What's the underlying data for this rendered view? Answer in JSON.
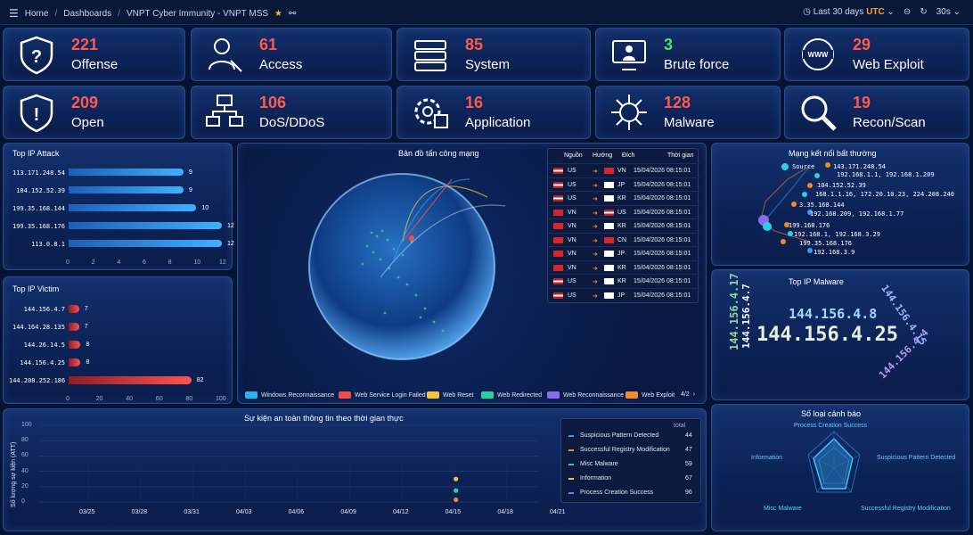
{
  "topbar": {
    "home": "Home",
    "dashboards": "Dashboards",
    "title": "VNPT Cyber Immunity - VNPT MSS",
    "time_range": "Last 30 days",
    "timezone": "UTC",
    "refresh": "30s"
  },
  "stats": [
    {
      "value": "221",
      "label": "Offense",
      "icon": "shield-question-icon"
    },
    {
      "value": "61",
      "label": "Access",
      "icon": "user-key-icon"
    },
    {
      "value": "85",
      "label": "System",
      "icon": "server-icon"
    },
    {
      "value": "3",
      "label": "Brute force",
      "icon": "monitor-user-icon"
    },
    {
      "value": "29",
      "label": "Web Exploit",
      "icon": "www-globe-icon"
    },
    {
      "value": "209",
      "label": "Open",
      "icon": "shield-alert-icon"
    },
    {
      "value": "106",
      "label": "DoS/DDoS",
      "icon": "network-computers-icon"
    },
    {
      "value": "16",
      "label": "Application",
      "icon": "gear-app-icon"
    },
    {
      "value": "128",
      "label": "Malware",
      "icon": "virus-icon"
    },
    {
      "value": "19",
      "label": "Recon/Scan",
      "icon": "magnifier-icon"
    }
  ],
  "top_ip_attack": {
    "title": "Top IP Attack",
    "items": [
      {
        "ip": "113.171.248.54",
        "value": 9
      },
      {
        "ip": "104.152.52.39",
        "value": 9
      },
      {
        "ip": "199.35.168.144",
        "value": 10
      },
      {
        "ip": "199.35.168.176",
        "value": 12
      },
      {
        "ip": "113.0.8.1",
        "value": 12
      }
    ],
    "ticks": [
      "0",
      "2",
      "4",
      "6",
      "8",
      "10",
      "12"
    ],
    "max": 12,
    "color": "#2f9bf2"
  },
  "top_ip_victim": {
    "title": "Top IP Victim",
    "items": [
      {
        "ip": "144.156.4.7",
        "value": 7
      },
      {
        "ip": "144.164.28.135",
        "value": 7
      },
      {
        "ip": "144.26.14.5",
        "value": 8
      },
      {
        "ip": "144.156.4.25",
        "value": 8
      },
      {
        "ip": "144.208.252.186",
        "value": 82
      }
    ],
    "ticks": [
      "0",
      "20",
      "40",
      "60",
      "80",
      "100"
    ],
    "max": 100,
    "color": "#ff4b4b"
  },
  "attack_map": {
    "title": "Bản đồ tấn công mạng",
    "headers": {
      "source": "Nguồn",
      "direction": "Hướng",
      "dest": "Đích",
      "time": "Thời gian"
    },
    "rows": [
      {
        "src": "US",
        "dst": "VN",
        "time": "15/04/2026 08:15:01"
      },
      {
        "src": "US",
        "dst": "JP",
        "time": "15/04/2026 08:15:01"
      },
      {
        "src": "US",
        "dst": "KR",
        "time": "15/04/2026 08:15:01"
      },
      {
        "src": "VN",
        "dst": "US",
        "time": "15/04/2026 08:15:01"
      },
      {
        "src": "VN",
        "dst": "KR",
        "time": "15/04/2026 08:15:01"
      },
      {
        "src": "VN",
        "dst": "CN",
        "time": "15/04/2026 08:15:01"
      },
      {
        "src": "VN",
        "dst": "JP",
        "time": "15/04/2026 08:15:01"
      },
      {
        "src": "VN",
        "dst": "KR",
        "time": "15/04/2026 08:15:01"
      },
      {
        "src": "US",
        "dst": "KR",
        "time": "15/04/2026 08:15:01"
      },
      {
        "src": "US",
        "dst": "JP",
        "time": "15/04/2026 08:15:01"
      }
    ],
    "legend": [
      {
        "label": "Windows Reconnaissance",
        "color": "#2bb3ef"
      },
      {
        "label": "Web Service Login Failed",
        "color": "#ef4b4b"
      },
      {
        "label": "Web Reset",
        "color": "#f2c53d"
      },
      {
        "label": "Web Redirected",
        "color": "#2ad0a0"
      },
      {
        "label": "Web Reconnaissance",
        "color": "#8a6cf0"
      },
      {
        "label": "Web Exploit",
        "color": "#f28a2b"
      }
    ],
    "page": "4/2"
  },
  "network": {
    "title": "Mạng kết nối bất thường",
    "source_label": "Source",
    "nodes": [
      "143.171.248.54",
      "192.168.1.1, 192.168.1.209",
      "104.152.52.39",
      "168.1.1.16, 172.20.10.23, 224.208.240",
      "3.35.168.144",
      "192.168.209, 192.168.1.77",
      "199.168.176",
      "192.168.1, 192.168.3.29",
      "199.35.168.176",
      "192.168.3.9"
    ]
  },
  "top_malware": {
    "title": "Top IP Malware",
    "words": [
      "144.156.4.17",
      "144.156.4.7",
      "144.156.4.8",
      "144.156.4.25",
      "144.156.4.15",
      "144.156.4.4"
    ]
  },
  "events": {
    "title": "Sự kiện an toàn thông tin theo thời gian thực",
    "ylabel": "Số lượng sự kiện (ATT)",
    "yticks": [
      "100",
      "80",
      "60",
      "40",
      "20",
      "0"
    ],
    "xticks": [
      "03/25",
      "03/28",
      "03/31",
      "04/03",
      "04/06",
      "04/09",
      "04/12",
      "04/15",
      "04/18",
      "04/21"
    ],
    "total_label": "total",
    "legend": [
      {
        "label": "Suspicious Pattern Detected",
        "value": "44",
        "color": "#3a9bf5"
      },
      {
        "label": "Successful Registry Modification",
        "value": "47",
        "color": "#f28a2b"
      },
      {
        "label": "Misc Malware",
        "value": "59",
        "color": "#2ad0a0"
      },
      {
        "label": "Information",
        "value": "67",
        "color": "#f2c53d"
      },
      {
        "label": "Process Creation Success",
        "value": "96",
        "color": "#8a6cf0"
      }
    ]
  },
  "chart_data": {
    "type": "scatter",
    "title": "Sự kiện an toàn thông tin theo thời gian thực",
    "ylabel": "Số lượng sự kiện (ATT)",
    "ylim": [
      0,
      100
    ],
    "series": [
      {
        "name": "Information",
        "x": [
          "04/15"
        ],
        "y": [
          30
        ]
      },
      {
        "name": "Misc Malware",
        "x": [
          "04/15"
        ],
        "y": [
          15
        ]
      },
      {
        "name": "Successful Registry Modification",
        "x": [
          "04/15"
        ],
        "y": [
          3
        ]
      }
    ]
  },
  "alerts": {
    "title": "Số loại cảnh báo",
    "axes": [
      "Process Creation Success",
      "Suspicious Pattern Detected",
      "Successful Registry Modification",
      "Misc Malware",
      "Information"
    ]
  }
}
